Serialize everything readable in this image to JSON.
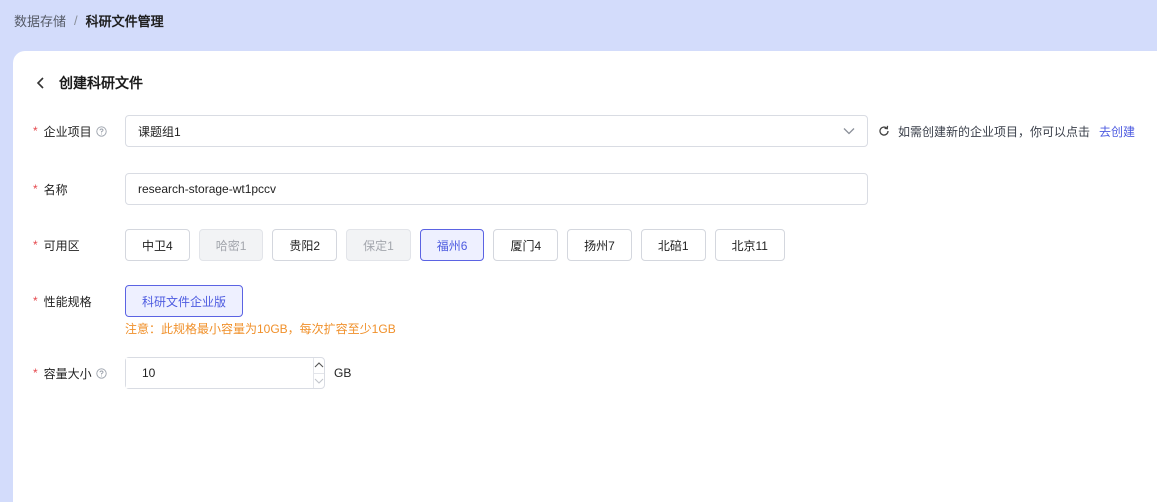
{
  "breadcrumb": {
    "parent": "数据存储",
    "separator": "/",
    "current": "科研文件管理"
  },
  "header": {
    "title": "创建科研文件",
    "back_icon": "chevron-left-icon"
  },
  "form": {
    "required_mark": "*",
    "project": {
      "label": "企业项目",
      "value": "课题组1",
      "hint": "如需创建新的企业项目，你可以点击",
      "create_link": "去创建"
    },
    "name": {
      "label": "名称",
      "value": "research-storage-wt1pccv"
    },
    "zone": {
      "label": "可用区",
      "options": [
        {
          "label": "中卫4",
          "state": "normal"
        },
        {
          "label": "哈密1",
          "state": "disabled"
        },
        {
          "label": "贵阳2",
          "state": "normal"
        },
        {
          "label": "保定1",
          "state": "disabled"
        },
        {
          "label": "福州6",
          "state": "selected"
        },
        {
          "label": "厦门4",
          "state": "normal"
        },
        {
          "label": "扬州7",
          "state": "normal"
        },
        {
          "label": "北碚1",
          "state": "normal"
        },
        {
          "label": "北京11",
          "state": "normal"
        }
      ]
    },
    "spec": {
      "label": "性能规格",
      "option": "科研文件企业版",
      "note": "注意：此规格最小容量为10GB，每次扩容至少1GB"
    },
    "capacity": {
      "label": "容量大小",
      "value": "10",
      "unit": "GB"
    }
  },
  "colors": {
    "accent": "#4d5be0",
    "background": "#d3dcfb",
    "warning": "#f0902a",
    "required": "#e5484d"
  }
}
